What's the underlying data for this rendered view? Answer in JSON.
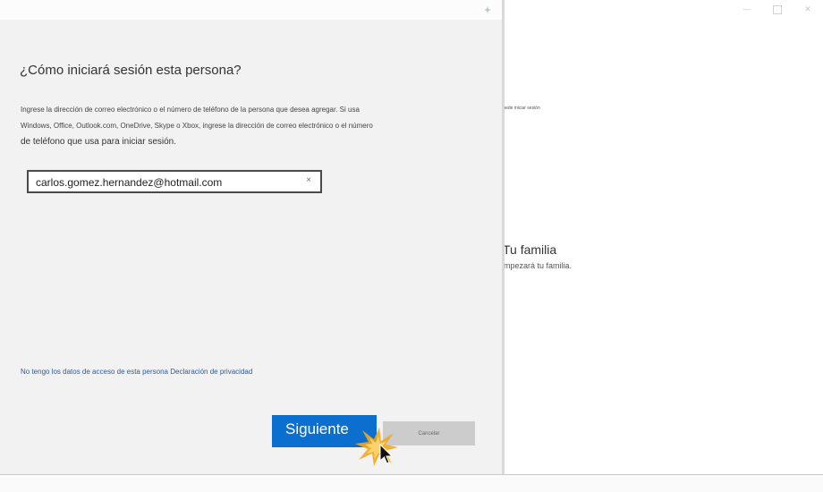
{
  "background_window": {
    "side_label": "Puede iniciar sesión",
    "heading": "Tu familia",
    "subtext": "empezará tu familia.",
    "controls": {
      "minimize": "—",
      "close": "✕"
    }
  },
  "dialog": {
    "title": "¿Cómo iniciará sesión esta persona?",
    "instruction_line1": "Ingrese la dirección de correo electrónico o el número de teléfono de la persona que desea agregar. Si usa",
    "instruction_line2": "Windows, Office, Outlook.com, OneDrive, Skype o Xbox, ingrese la dirección de correo electrónico o el número",
    "instruction_line3": "de teléfono que usa para iniciar sesión.",
    "email_value": "carlos.gomez.hernandez@hotmail.com",
    "clear_glyph": "×",
    "link_no_data": "No tengo los datos de acceso de esta persona",
    "link_privacy": "Declaración de privacidad",
    "next_label": "Siguiente",
    "cancel_label": "Cancelar"
  },
  "colors": {
    "accent": "#0b6fd0",
    "dialog_bg": "#f2f2f2",
    "cancel_bg": "#cccccc",
    "link": "#2a5a9a"
  }
}
